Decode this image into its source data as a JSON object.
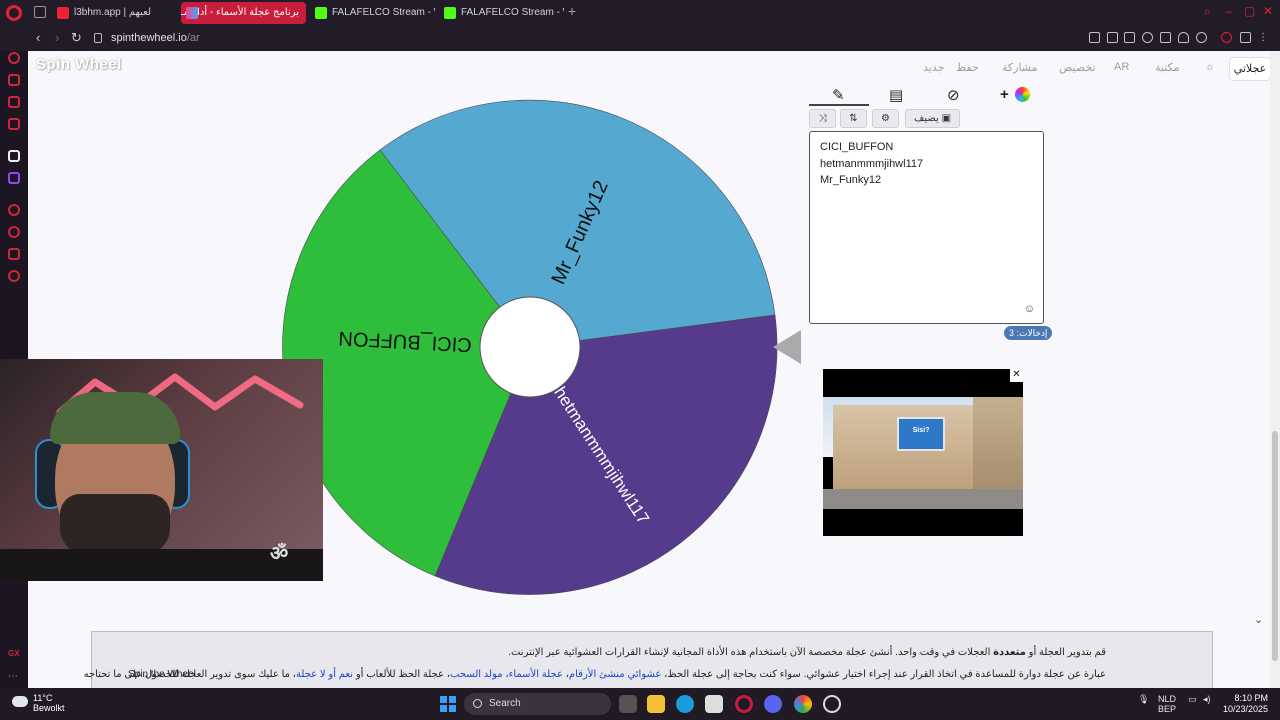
{
  "browser": {
    "tabs": [
      {
        "label": "l3bhm.app | لعبهم",
        "active": false,
        "favicon_color": "#e33"
      },
      {
        "label": "برنامج عجلة الأسماء - أداة مـ",
        "active": true,
        "favicon_color": "#ff3d8a"
      },
      {
        "label": "FALAFELCO Stream - Wat",
        "active": false,
        "favicon_color": "#53fc18"
      },
      {
        "label": "FALAFELCO Stream - Wat",
        "active": false,
        "favicon_color": "#53fc18"
      }
    ],
    "url_host": "spinthewheel.io",
    "url_path": "/ar"
  },
  "site": {
    "logo": "Spin Wheel",
    "tools": [
      "جديد",
      "حفظ",
      "مشاركة",
      "تخصيص",
      "AR",
      "مكتبة"
    ],
    "top_button": "عجلاتي"
  },
  "wheel": {
    "segments": [
      {
        "label": "Mr_Funky12",
        "color": "#55a8d0"
      },
      {
        "label": "hetmanmmmjihwl117",
        "color": "#563a8b"
      },
      {
        "label": "CICI_BUFFON",
        "color": "#2fbd3c"
      }
    ]
  },
  "editor": {
    "tab_icons": [
      "pencil-icon",
      "clipboard-icon",
      "eye-off-icon",
      "plus-color-icon"
    ],
    "buttons": {
      "shuffle": "⤨",
      "sort": "⇅",
      "settings": "⚙",
      "add_image": "يضيف"
    },
    "entries": [
      "CICI_BUFFON",
      "hetmanmmmjihwl117",
      "Mr_Funky12"
    ],
    "entries_count_label": "إدخالات: 3",
    "emoji": "☺"
  },
  "ad": {
    "close": "✕",
    "billboard": "Sisi?"
  },
  "description": {
    "line1_pre": "قم بتدوير العجلة أو ",
    "line1_bold": "متعددة",
    "line1_post": " العجلات في وقت واحد. أنشئ عجلة مخصصة الآن باستخدام هذه الأداة المجانية لإنشاء القرارات العشوائية عبر الإنترنت.",
    "line2_a": "عبارة عن عجلة دوارة للمساعدة في اتخاذ القرار عند إجراء اختيار عشوائي. سواء كنت بحاجة إلى عجلة الحظ، ",
    "link1": "عشوائي منشئ الأرقام",
    "sep1": "، ",
    "link2": "عجلة الأسماء",
    "sep2": "، ",
    "link3": "مولد السحب",
    "line2_b": "، عجلة الحظ للألعاب أو ",
    "link4": "نعم أو لا عجلة",
    "line2_c": "، ما عليك سوى تدوير العجلة للحصول على ما تحتاجه ",
    "brand": "Spin the Wheel"
  },
  "taskbar": {
    "temp": "11°C",
    "condition": "Bewolkt",
    "search": "Search",
    "lang": "NLD",
    "lang2": "BEP",
    "time": "8:10 PM",
    "date": "10/23/2025"
  }
}
